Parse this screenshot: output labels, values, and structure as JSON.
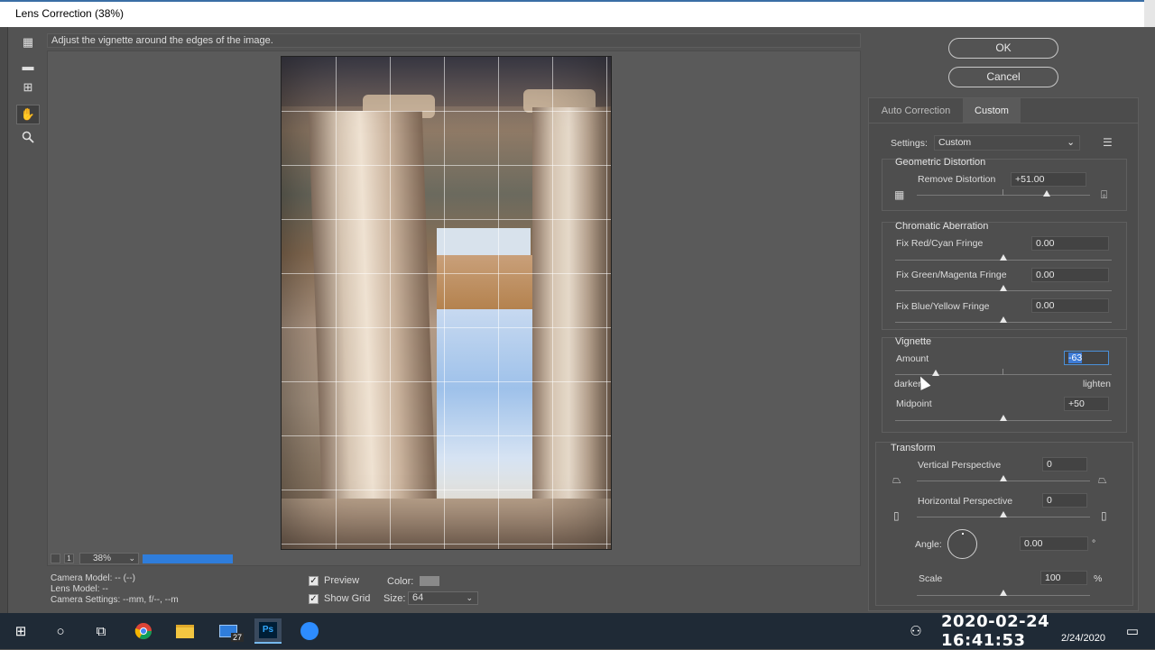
{
  "window": {
    "title": "Lens Correction (38%)"
  },
  "hint": "Adjust the vignette around the edges of the image.",
  "tools": [
    "remove-distortion-tool",
    "straighten-tool",
    "move-grid-tool",
    "hand-tool",
    "zoom-tool"
  ],
  "zoom": {
    "value": "38%"
  },
  "camera_info": {
    "model": "Camera Model: -- (--)",
    "lens": "Lens Model: --",
    "settings": "Camera Settings: --mm, f/--, --m"
  },
  "preview": {
    "preview_label": "Preview",
    "show_grid_label": "Show Grid",
    "color_label": "Color:",
    "size_label": "Size:",
    "size_value": "64"
  },
  "buttons": {
    "ok": "OK",
    "cancel": "Cancel"
  },
  "tabs": {
    "auto": "Auto Correction",
    "custom": "Custom"
  },
  "settings": {
    "label": "Settings:",
    "value": "Custom"
  },
  "geometric": {
    "title": "Geometric Distortion",
    "remove_label": "Remove Distortion",
    "remove_value": "+51.00",
    "remove_level": 0.51
  },
  "chromatic": {
    "title": "Chromatic Aberration",
    "red_label": "Fix Red/Cyan Fringe",
    "red_value": "0.00",
    "green_label": "Fix Green/Magenta Fringe",
    "green_value": "0.00",
    "blue_label": "Fix Blue/Yellow Fringe",
    "blue_value": "0.00"
  },
  "vignette": {
    "title": "Vignette",
    "amount_label": "Amount",
    "amount_value": "-63",
    "amount_level": -63,
    "darken": "darken",
    "lighten": "lighten",
    "midpoint_label": "Midpoint",
    "midpoint_value": "+50"
  },
  "transform": {
    "title": "Transform",
    "vertical_label": "Vertical Perspective",
    "vertical_value": "0",
    "horizontal_label": "Horizontal Perspective",
    "horizontal_value": "0",
    "angle_label": "Angle:",
    "angle_value": "0.00",
    "angle_unit": "°",
    "scale_label": "Scale",
    "scale_value": "100",
    "scale_unit": "%"
  },
  "taskbar": {
    "badge": "27",
    "clock_overlay": "2020-02-24  16:41:53",
    "date": "2/24/2020"
  }
}
